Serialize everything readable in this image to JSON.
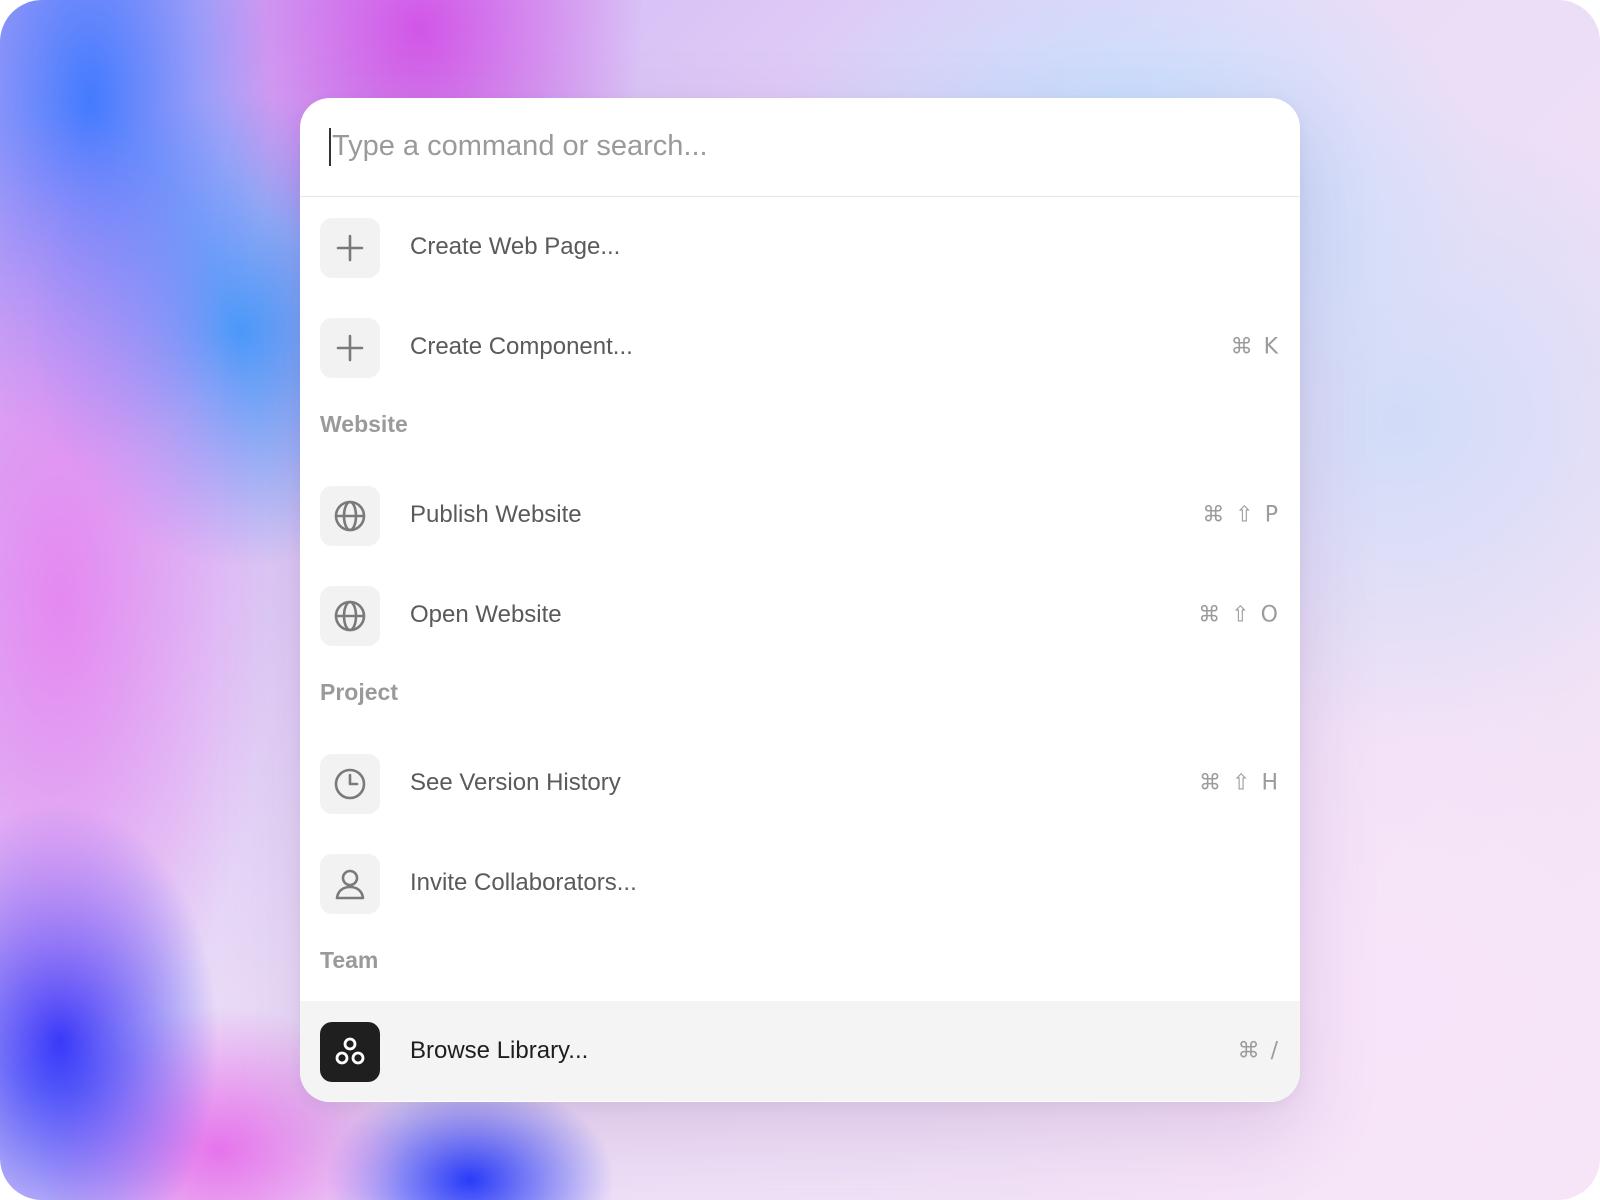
{
  "search": {
    "placeholder": "Type a command or search...",
    "value": ""
  },
  "commands_top": [
    {
      "label": "Create Web Page...",
      "icon": "plus-icon",
      "shortcut": ""
    },
    {
      "label": "Create Component...",
      "icon": "plus-icon",
      "shortcut": "⌘ K"
    }
  ],
  "sections": [
    {
      "title": "Website",
      "items": [
        {
          "label": "Publish Website",
          "icon": "globe-icon",
          "shortcut": "⌘ ⇧ P"
        },
        {
          "label": "Open Website",
          "icon": "globe-icon",
          "shortcut": "⌘ ⇧ O"
        }
      ]
    },
    {
      "title": "Project",
      "items": [
        {
          "label": "See Version History",
          "icon": "clock-icon",
          "shortcut": "⌘ ⇧ H"
        },
        {
          "label": "Invite Collaborators...",
          "icon": "user-icon",
          "shortcut": ""
        }
      ]
    },
    {
      "title": "Team",
      "items": [
        {
          "label": "Browse Library...",
          "icon": "library-icon",
          "shortcut": "⌘ /",
          "selected": true
        }
      ]
    }
  ],
  "colors": {
    "selected_row": "#f4f4f4",
    "icon_tile": "#f2f2f2",
    "icon_tile_dark": "#1f1f1f",
    "section_title": "#9a9a9a"
  }
}
